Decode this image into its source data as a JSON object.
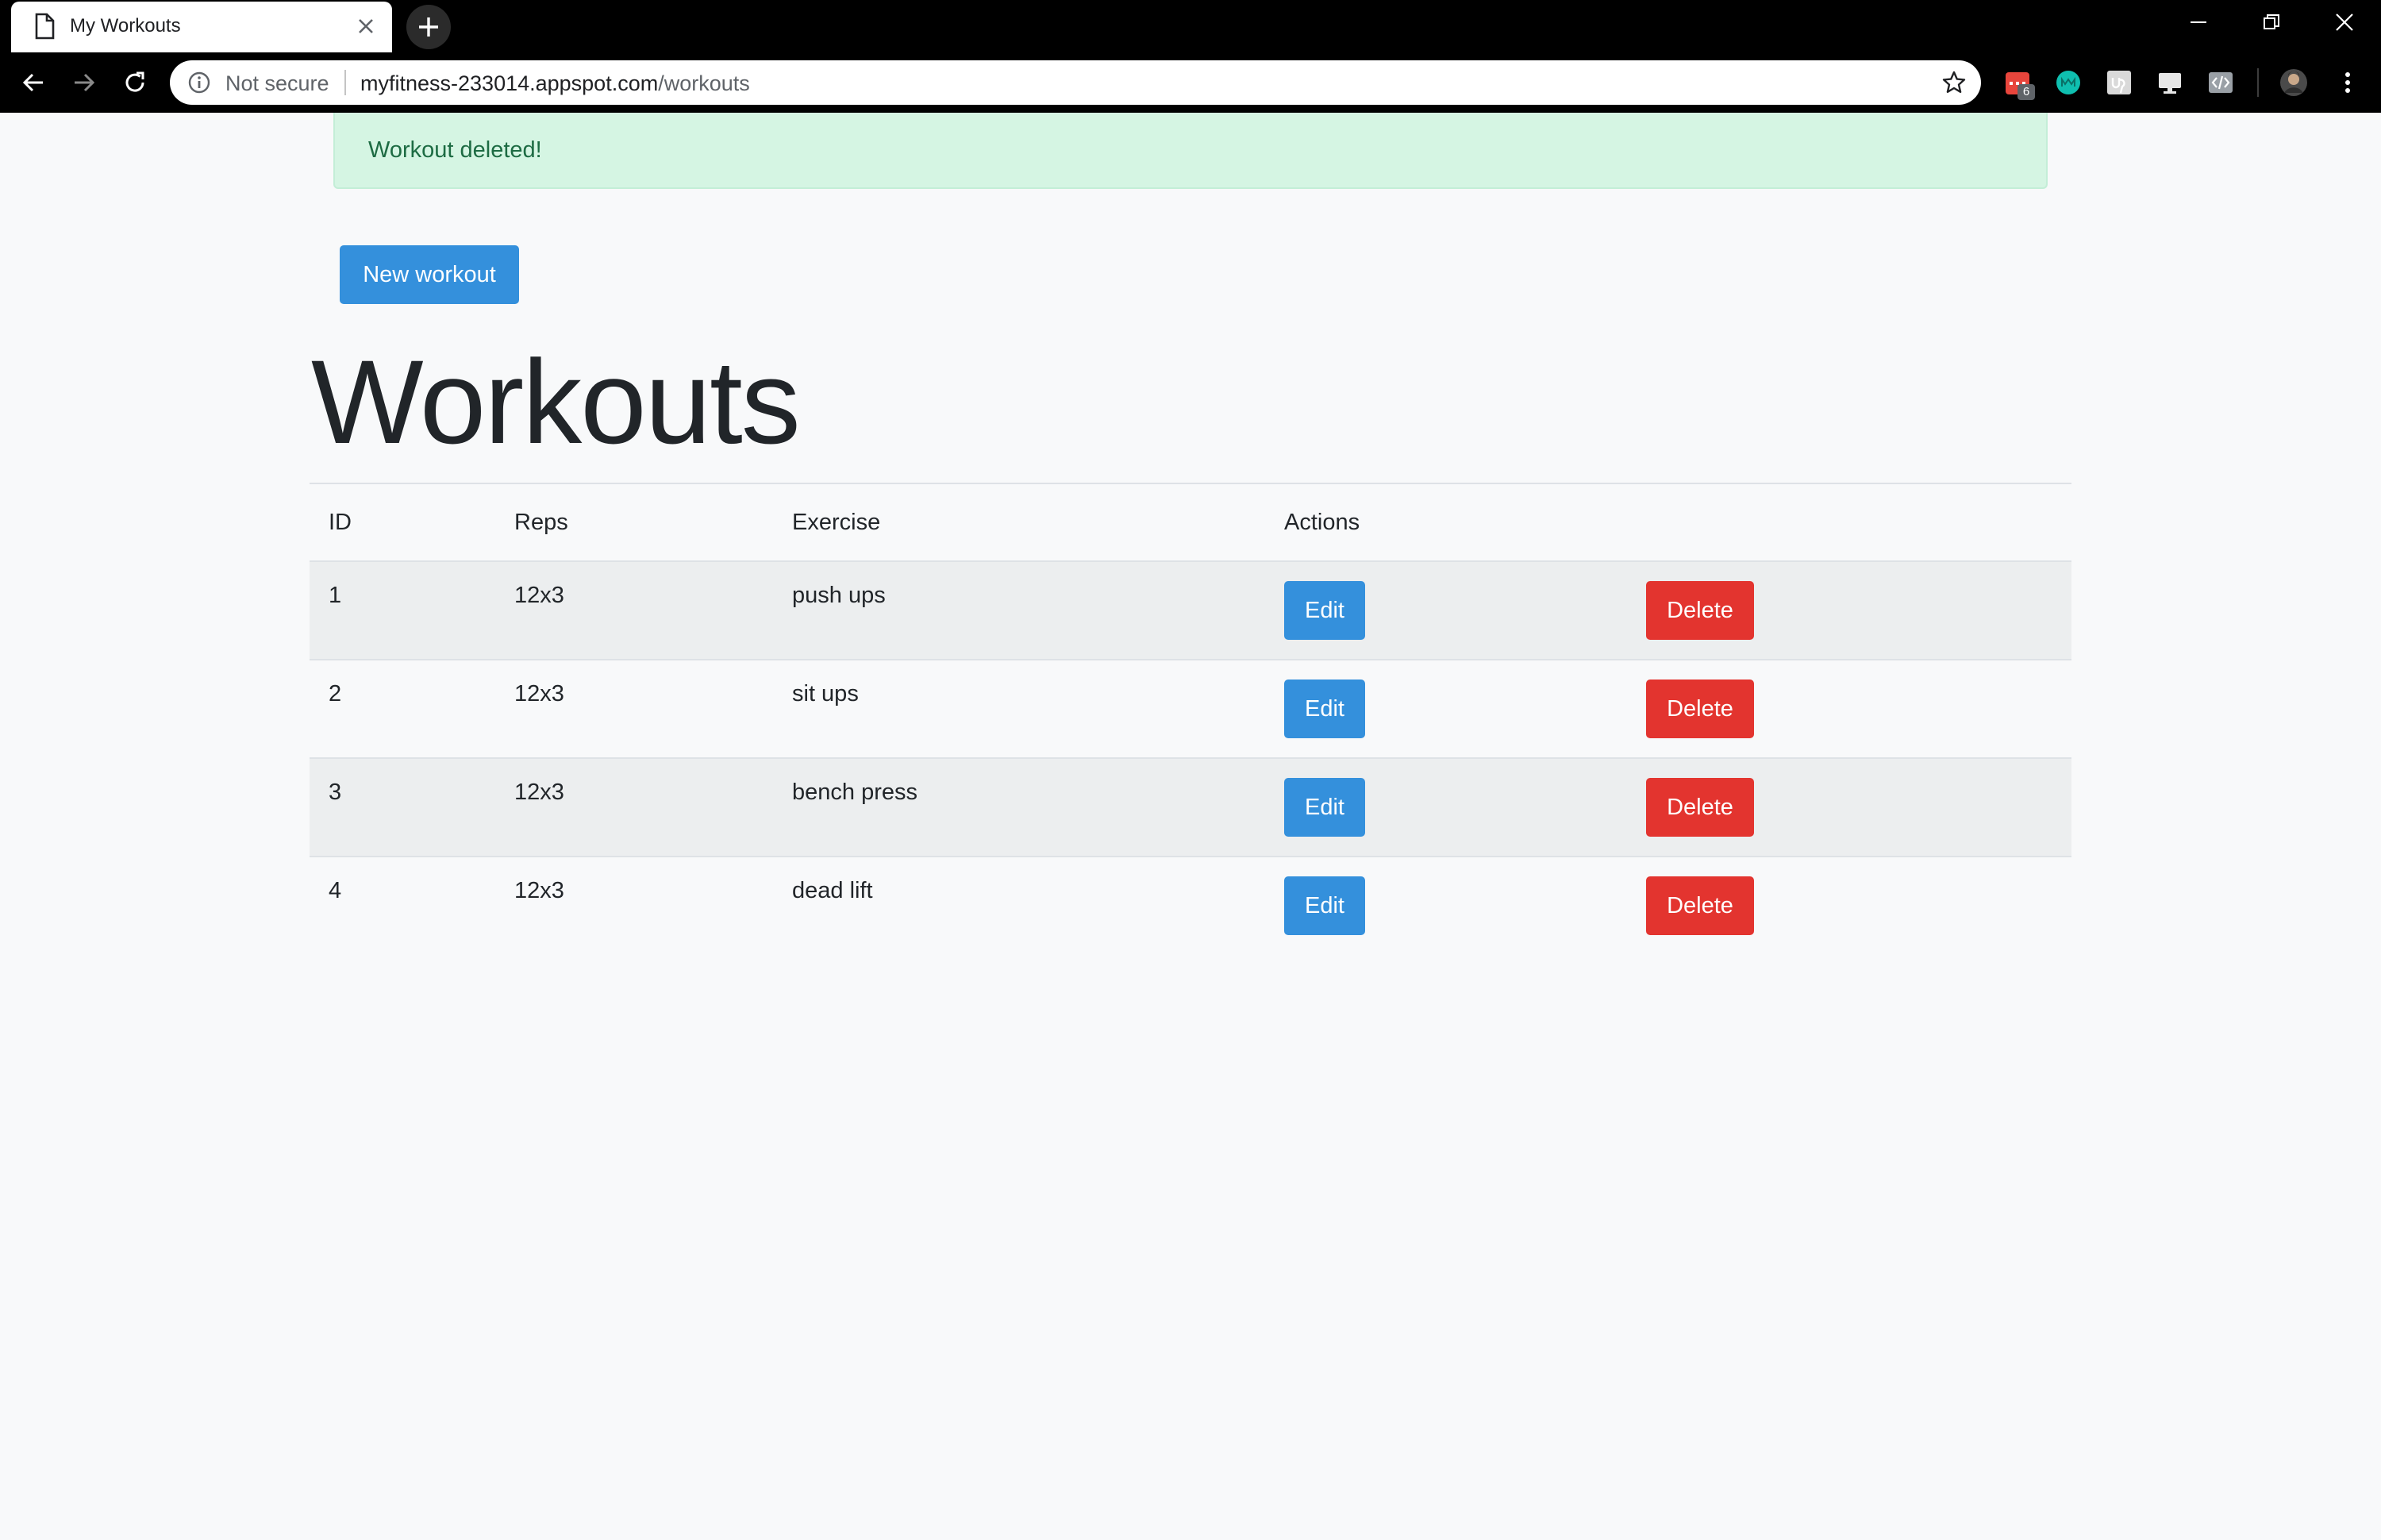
{
  "browser": {
    "tab_title": "My Workouts",
    "security_label": "Not secure",
    "url_host": "myfitness-233014.appspot.com",
    "url_path": "/workouts",
    "extension_badge": "6"
  },
  "alert": {
    "message": "Workout deleted!"
  },
  "page": {
    "new_button_label": "New workout",
    "title": "Workouts"
  },
  "table": {
    "headers": {
      "id": "ID",
      "reps": "Reps",
      "exercise": "Exercise",
      "actions": "Actions"
    },
    "rows": [
      {
        "id": "1",
        "reps": "12x3",
        "exercise": "push ups",
        "edit": "Edit",
        "delete": "Delete"
      },
      {
        "id": "2",
        "reps": "12x3",
        "exercise": "sit ups",
        "edit": "Edit",
        "delete": "Delete"
      },
      {
        "id": "3",
        "reps": "12x3",
        "exercise": "bench press",
        "edit": "Edit",
        "delete": "Delete"
      },
      {
        "id": "4",
        "reps": "12x3",
        "exercise": "dead lift",
        "edit": "Edit",
        "delete": "Delete"
      }
    ]
  },
  "colors": {
    "primary": "#3490dc",
    "danger": "#e3342f",
    "success_bg": "#d5f5e3",
    "success_text": "#1d6b43"
  },
  "icons": {
    "tab": "page-icon",
    "close": "close-icon",
    "new_tab": "plus-icon",
    "back": "back-arrow-icon",
    "forward": "forward-arrow-icon",
    "reload": "reload-icon",
    "info": "info-icon",
    "bookmark": "star-icon",
    "menu": "kebab-menu-icon"
  }
}
